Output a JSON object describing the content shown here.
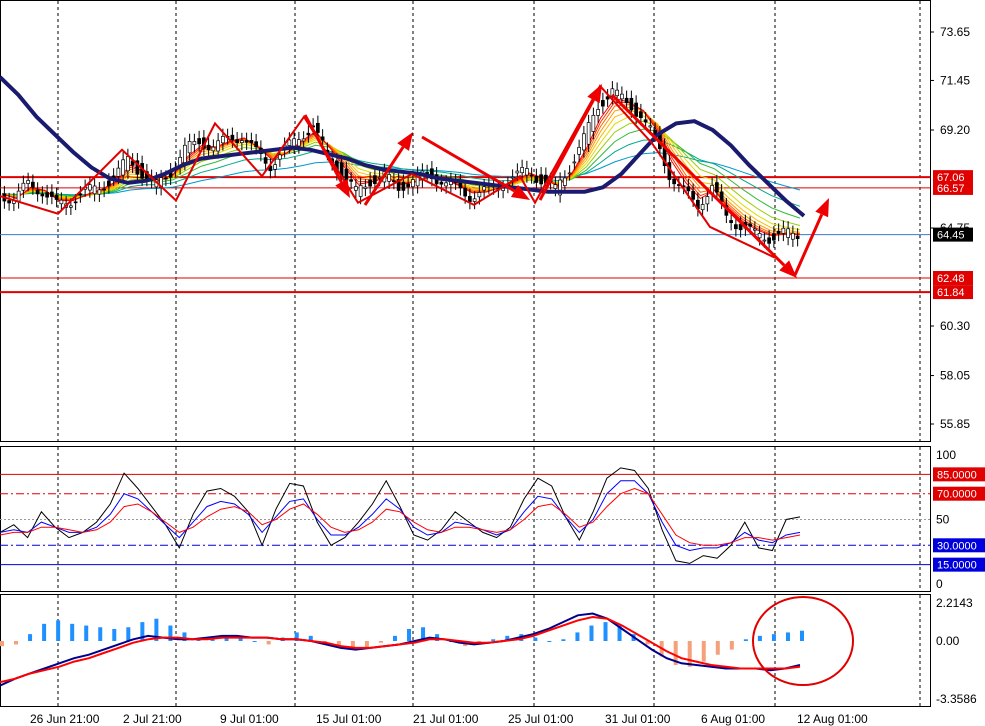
{
  "chart_data": [
    {
      "type": "line",
      "panel": "price",
      "y_ticks": [
        "73.65",
        "71.45",
        "69.20",
        "64.75",
        "60.30",
        "58.05",
        "55.85"
      ],
      "ylim": [
        54.9,
        75.3
      ],
      "current_price": {
        "label": "64.45",
        "value": 64.45
      },
      "levels": [
        {
          "label": "67.06",
          "value": 67.06,
          "color": "#e00000"
        },
        {
          "label": "66.57",
          "value": 66.57,
          "color": "#e00000"
        },
        {
          "label": "62.48",
          "value": 62.48,
          "color": "#e00000"
        },
        {
          "label": "61.84",
          "value": 61.84,
          "color": "#e00000"
        }
      ],
      "x_ticks": [
        "26 Jun 21:00",
        "2 Jul 21:00",
        "9 Jul 01:00",
        "15 Jul 01:00",
        "21 Jul 01:00",
        "25 Jul 01:00",
        "31 Jul 01:00",
        "6 Aug 01:00",
        "12 Aug 01:00"
      ],
      "close_series": [
        66.3,
        66.0,
        66.8,
        66.4,
        65.8,
        66.0,
        66.4,
        66.6,
        67.0,
        67.9,
        67.2,
        66.7,
        67.3,
        68.3,
        68.7,
        68.4,
        68.8,
        68.9,
        68.2,
        67.6,
        68.3,
        68.9,
        69.3,
        68.1,
        67.2,
        66.4,
        66.9,
        67.1,
        66.6,
        66.9,
        67.2,
        66.9,
        66.6,
        66.2,
        66.4,
        66.7,
        67.0,
        67.4,
        66.9,
        66.5,
        67.5,
        68.8,
        70.3,
        71.0,
        70.4,
        69.9,
        68.8,
        67.2,
        66.4,
        65.8,
        66.6,
        65.3,
        64.8,
        64.5,
        64.3,
        64.5,
        64.45
      ],
      "slow_ma_series": [
        71.6,
        70.8,
        69.8,
        69.0,
        68.2,
        67.5,
        67.0,
        66.8,
        66.9,
        67.2,
        67.6,
        67.9,
        68.0,
        68.1,
        68.2,
        68.3,
        68.4,
        68.3,
        68.1,
        67.9,
        67.6,
        67.4,
        67.3,
        67.2,
        67.0,
        66.9,
        66.8,
        66.7,
        66.6,
        66.5,
        66.4,
        66.4,
        66.4,
        66.6,
        67.2,
        68.1,
        69.0,
        69.5,
        69.6,
        69.2,
        68.5,
        67.6,
        66.8,
        66.0,
        65.3
      ],
      "arrows_color": "#ee0000"
    },
    {
      "type": "line",
      "panel": "stochastic",
      "y_ticks": [
        "100",
        "50",
        "0"
      ],
      "ylim": [
        0,
        100
      ],
      "levels": [
        {
          "label": "85.0000",
          "value": 85,
          "color": "#e00000",
          "style": "solid"
        },
        {
          "label": "70.0000",
          "value": 70,
          "color": "#e00000",
          "style": "dashdot"
        },
        {
          "label": "30.0000",
          "value": 30,
          "color": "#0000dd",
          "style": "dashdot"
        },
        {
          "label": "15.0000",
          "value": 15,
          "color": "#0000dd",
          "style": "solid"
        }
      ],
      "series": [
        {
          "color": "#000000",
          "values": [
            40,
            46,
            36,
            56,
            44,
            36,
            40,
            48,
            62,
            86,
            74,
            60,
            46,
            28,
            54,
            72,
            74,
            68,
            56,
            30,
            58,
            78,
            76,
            48,
            30,
            36,
            48,
            62,
            80,
            60,
            38,
            34,
            42,
            56,
            48,
            40,
            36,
            44,
            66,
            82,
            76,
            52,
            34,
            56,
            82,
            90,
            88,
            74,
            42,
            18,
            16,
            22,
            20,
            30,
            48,
            28,
            26,
            50,
            52
          ]
        },
        {
          "color": "#0000ff",
          "values": [
            40,
            42,
            40,
            48,
            44,
            40,
            40,
            44,
            54,
            70,
            66,
            56,
            46,
            36,
            48,
            60,
            64,
            62,
            54,
            40,
            52,
            64,
            66,
            50,
            38,
            38,
            44,
            54,
            66,
            58,
            44,
            38,
            40,
            48,
            46,
            42,
            38,
            42,
            56,
            68,
            66,
            52,
            40,
            50,
            70,
            80,
            80,
            70,
            48,
            30,
            26,
            28,
            28,
            32,
            40,
            34,
            32,
            38,
            40
          ]
        },
        {
          "color": "#ff0000",
          "values": [
            38,
            40,
            40,
            44,
            44,
            42,
            40,
            42,
            48,
            60,
            62,
            56,
            48,
            40,
            44,
            52,
            58,
            60,
            56,
            46,
            50,
            58,
            62,
            54,
            44,
            40,
            42,
            48,
            58,
            56,
            48,
            42,
            40,
            44,
            44,
            42,
            40,
            42,
            50,
            60,
            62,
            54,
            44,
            48,
            60,
            70,
            74,
            70,
            54,
            38,
            32,
            30,
            30,
            32,
            36,
            36,
            34,
            36,
            38
          ]
        }
      ]
    },
    {
      "type": "bar",
      "panel": "macd",
      "y_ticks": [
        "2.2143",
        "0.00",
        "-3.3586"
      ],
      "ylim": [
        -3.3586,
        2.2143
      ],
      "histogram": [
        -0.3,
        -0.2,
        0.4,
        1.0,
        1.2,
        1.0,
        0.9,
        0.8,
        0.7,
        0.8,
        1.1,
        1.3,
        0.9,
        0.5,
        0.1,
        0.2,
        0.3,
        0.2,
        0.0,
        -0.2,
        0.2,
        0.5,
        0.3,
        -0.1,
        -0.4,
        -0.5,
        -0.4,
        -0.1,
        0.3,
        0.7,
        0.8,
        0.4,
        0.0,
        -0.3,
        -0.2,
        0.1,
        0.3,
        0.4,
        0.2,
        0.0,
        0.1,
        0.5,
        0.9,
        1.1,
        0.9,
        0.4,
        -0.2,
        -0.9,
        -1.4,
        -1.5,
        -1.2,
        -0.8,
        -0.5,
        0.1,
        0.3,
        0.4,
        0.5,
        0.6
      ],
      "histogram_colors": {
        "positive": "#1e90ff",
        "negative": "#f4a07a"
      },
      "series": [
        {
          "color": "#00008b",
          "values": [
            -2.6,
            -2.2,
            -1.9,
            -1.6,
            -1.3,
            -1.0,
            -0.8,
            -0.5,
            -0.2,
            0.1,
            0.3,
            0.2,
            0.1,
            0.1,
            0.2,
            0.3,
            0.3,
            0.2,
            0.2,
            0.1,
            0.1,
            0.0,
            -0.2,
            -0.4,
            -0.5,
            -0.4,
            -0.3,
            -0.2,
            0.0,
            0.2,
            0.1,
            -0.1,
            -0.2,
            -0.1,
            0.0,
            0.2,
            0.4,
            0.7,
            1.1,
            1.5,
            1.6,
            1.3,
            0.7,
            0.1,
            -0.5,
            -1.0,
            -1.3,
            -1.4,
            -1.5,
            -1.6,
            -1.6,
            -1.6,
            -1.7,
            -1.6,
            -1.4
          ]
        },
        {
          "color": "#ff0000",
          "values": [
            -2.4,
            -2.2,
            -1.9,
            -1.7,
            -1.5,
            -1.2,
            -1.0,
            -0.7,
            -0.4,
            -0.1,
            0.1,
            0.2,
            0.2,
            0.1,
            0.1,
            0.2,
            0.2,
            0.2,
            0.2,
            0.1,
            0.1,
            0.0,
            -0.1,
            -0.3,
            -0.4,
            -0.4,
            -0.3,
            -0.2,
            -0.1,
            0.1,
            0.1,
            0.0,
            -0.1,
            -0.1,
            0.0,
            0.1,
            0.3,
            0.6,
            0.9,
            1.2,
            1.4,
            1.3,
            0.9,
            0.4,
            -0.1,
            -0.6,
            -1.0,
            -1.2,
            -1.4,
            -1.5,
            -1.6,
            -1.6,
            -1.6,
            -1.6,
            -1.5
          ]
        }
      ],
      "annotation": "circle",
      "annotation_color": "#e00000"
    }
  ]
}
